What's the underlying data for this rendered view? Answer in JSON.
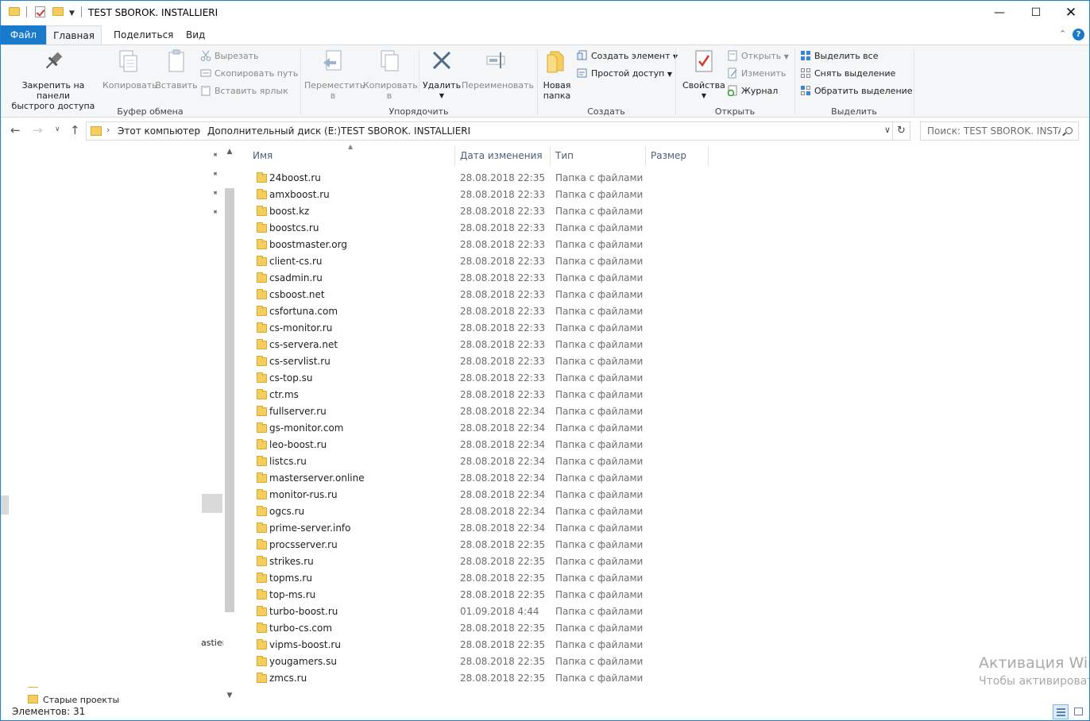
{
  "window": {
    "title": "TEST SBOROK. INSTALLIERI"
  },
  "ribbon_tabs": [
    "Файл",
    "Главная",
    "Поделиться",
    "Вид"
  ],
  "ribbon": {
    "clipboard": {
      "pin_label_1": "Закрепить на панели",
      "pin_label_2": "быстрого доступа",
      "copy": "Копировать",
      "paste": "Вставить",
      "cut": "Вырезать",
      "copy_path": "Скопировать путь",
      "paste_shortcut": "Вставить ярлык",
      "group": "Буфер обмена"
    },
    "organize": {
      "move_1": "Переместить",
      "move_2": "в",
      "copy_1": "Копировать",
      "copy_2": "в",
      "delete": "Удалить",
      "rename": "Переименовать",
      "group": "Упорядочить"
    },
    "create": {
      "new_folder_1": "Новая",
      "new_folder_2": "папка",
      "new_item": "Создать элемент",
      "easy_access": "Простой доступ",
      "group": "Создать"
    },
    "open": {
      "properties": "Свойства",
      "open": "Открыть",
      "edit": "Изменить",
      "history": "Журнал",
      "group": "Открыть"
    },
    "select": {
      "select_all": "Выделить все",
      "select_none": "Снять выделение",
      "invert": "Обратить выделение",
      "group": "Выделить"
    }
  },
  "address": {
    "crumbs": [
      "Этот компьютер",
      "Дополнительный диск (E:)",
      "TEST SBOROK. INSTALLIERI"
    ],
    "search_placeholder": "Поиск: TEST SBOROK. INSTA..."
  },
  "navpane": {
    "partial_label": "astier",
    "old_projects": "Старые проекты"
  },
  "columns": {
    "name": "Имя",
    "date": "Дата изменения",
    "type": "Тип",
    "size": "Размер"
  },
  "files": [
    {
      "name": "24boost.ru",
      "date": "28.08.2018 22:35",
      "type": "Папка с файлами"
    },
    {
      "name": "amxboost.ru",
      "date": "28.08.2018 22:33",
      "type": "Папка с файлами"
    },
    {
      "name": "boost.kz",
      "date": "28.08.2018 22:33",
      "type": "Папка с файлами"
    },
    {
      "name": "boostcs.ru",
      "date": "28.08.2018 22:33",
      "type": "Папка с файлами"
    },
    {
      "name": "boostmaster.org",
      "date": "28.08.2018 22:33",
      "type": "Папка с файлами"
    },
    {
      "name": "client-cs.ru",
      "date": "28.08.2018 22:33",
      "type": "Папка с файлами"
    },
    {
      "name": "csadmin.ru",
      "date": "28.08.2018 22:33",
      "type": "Папка с файлами"
    },
    {
      "name": "csboost.net",
      "date": "28.08.2018 22:33",
      "type": "Папка с файлами"
    },
    {
      "name": "csfortuna.com",
      "date": "28.08.2018 22:33",
      "type": "Папка с файлами"
    },
    {
      "name": "cs-monitor.ru",
      "date": "28.08.2018 22:33",
      "type": "Папка с файлами"
    },
    {
      "name": "cs-servera.net",
      "date": "28.08.2018 22:33",
      "type": "Папка с файлами"
    },
    {
      "name": "cs-servlist.ru",
      "date": "28.08.2018 22:33",
      "type": "Папка с файлами"
    },
    {
      "name": "cs-top.su",
      "date": "28.08.2018 22:33",
      "type": "Папка с файлами"
    },
    {
      "name": "ctr.ms",
      "date": "28.08.2018 22:33",
      "type": "Папка с файлами"
    },
    {
      "name": "fullserver.ru",
      "date": "28.08.2018 22:34",
      "type": "Папка с файлами"
    },
    {
      "name": "gs-monitor.com",
      "date": "28.08.2018 22:34",
      "type": "Папка с файлами"
    },
    {
      "name": "leo-boost.ru",
      "date": "28.08.2018 22:34",
      "type": "Папка с файлами"
    },
    {
      "name": "listcs.ru",
      "date": "28.08.2018 22:34",
      "type": "Папка с файлами"
    },
    {
      "name": "masterserver.online",
      "date": "28.08.2018 22:34",
      "type": "Папка с файлами"
    },
    {
      "name": "monitor-rus.ru",
      "date": "28.08.2018 22:34",
      "type": "Папка с файлами"
    },
    {
      "name": "ogcs.ru",
      "date": "28.08.2018 22:34",
      "type": "Папка с файлами"
    },
    {
      "name": "prime-server.info",
      "date": "28.08.2018 22:34",
      "type": "Папка с файлами"
    },
    {
      "name": "procsserver.ru",
      "date": "28.08.2018 22:35",
      "type": "Папка с файлами"
    },
    {
      "name": "strikes.ru",
      "date": "28.08.2018 22:35",
      "type": "Папка с файлами"
    },
    {
      "name": "topms.ru",
      "date": "28.08.2018 22:35",
      "type": "Папка с файлами"
    },
    {
      "name": "top-ms.ru",
      "date": "28.08.2018 22:35",
      "type": "Папка с файлами"
    },
    {
      "name": "turbo-boost.ru",
      "date": "01.09.2018 4:44",
      "type": "Папка с файлами"
    },
    {
      "name": "turbo-cs.com",
      "date": "28.08.2018 22:35",
      "type": "Папка с файлами"
    },
    {
      "name": "vipms-boost.ru",
      "date": "28.08.2018 22:35",
      "type": "Папка с файлами"
    },
    {
      "name": "yougamers.su",
      "date": "28.08.2018 22:35",
      "type": "Папка с файлами"
    },
    {
      "name": "zmcs.ru",
      "date": "28.08.2018 22:35",
      "type": "Папка с файлами"
    }
  ],
  "watermark": {
    "line1": "Активация Wind",
    "line2": "Чтобы активировать"
  },
  "status": {
    "items": "Элементов: 31"
  },
  "colors": {
    "accent": "#1979ca",
    "folder": "#f4cf5f",
    "header_text": "#4c607a",
    "secondary_text": "#6d6d6d"
  }
}
